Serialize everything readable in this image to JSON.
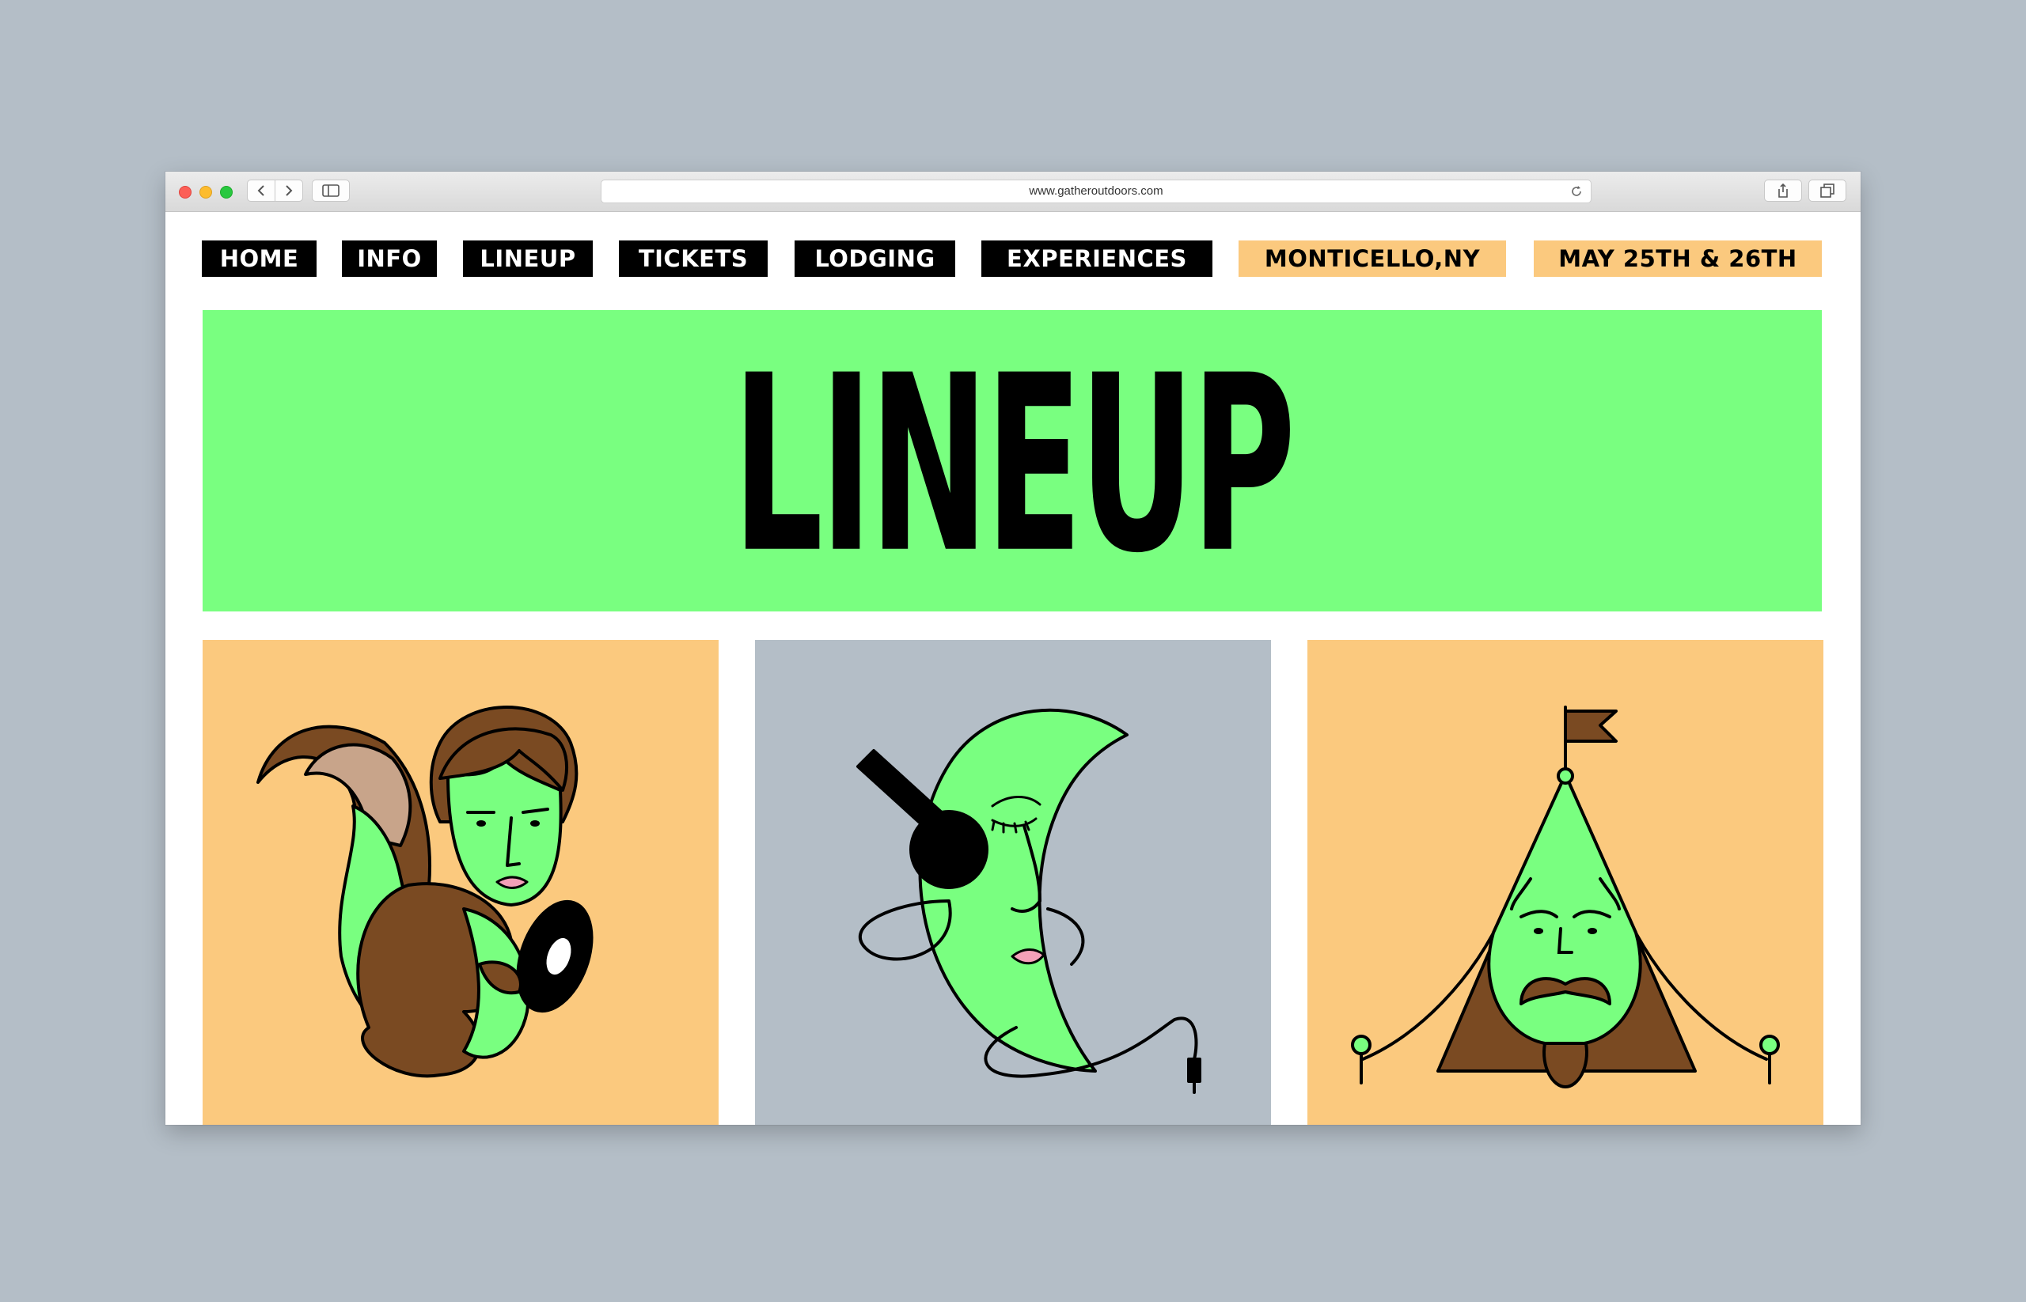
{
  "browser": {
    "url": "www.gatheroutdoors.com"
  },
  "nav": {
    "items": [
      {
        "label": "HOME"
      },
      {
        "label": "INFO"
      },
      {
        "label": "LINEUP"
      },
      {
        "label": "TICKETS"
      },
      {
        "label": "LODGING"
      },
      {
        "label": "EXPERIENCES"
      }
    ],
    "location": "MONTICELLO,NY",
    "dates": "MAY 25TH & 26TH"
  },
  "page": {
    "title": "LINEUP"
  },
  "lineup": [
    {
      "icon": "squirrel-dj-illustration",
      "bg": "#fbc97e"
    },
    {
      "icon": "moon-headphones-illustration",
      "bg": "#b4bec7"
    },
    {
      "icon": "tent-face-illustration",
      "bg": "#fbc97e"
    }
  ],
  "colors": {
    "green": "#79ff80",
    "orange": "#fbc97e",
    "gray": "#b4bec7",
    "brown": "#7a4a22",
    "black": "#000000"
  }
}
